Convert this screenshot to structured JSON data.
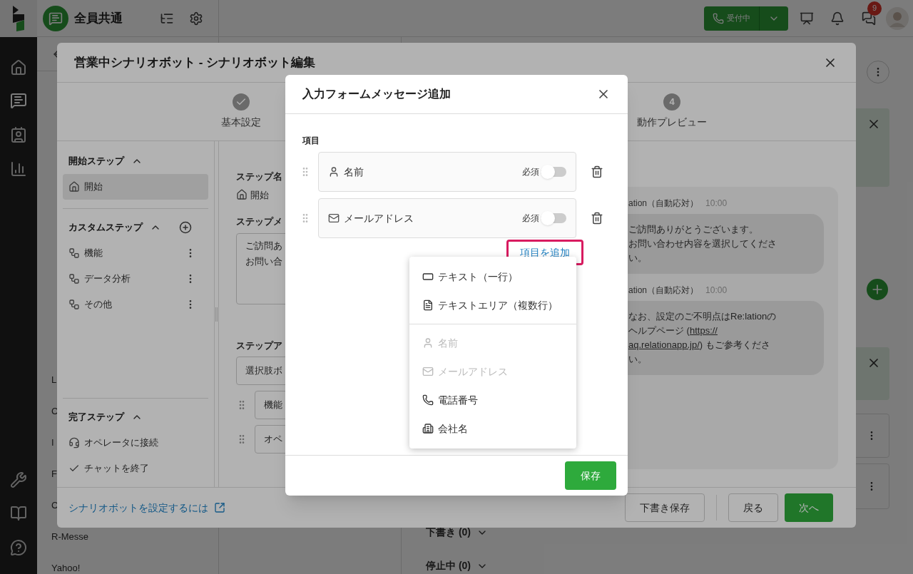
{
  "app": {
    "workspace": "全員共通",
    "status_button": "受付中",
    "badge": "9",
    "nav_list": [
      "L",
      "C",
      "I",
      "F",
      "C",
      "R-Messe",
      "Yahoo!"
    ],
    "sections": [
      {
        "label": "下書き (0)",
        "expanded": false
      },
      {
        "label": "停止中 (0)",
        "expanded": false
      }
    ]
  },
  "editor": {
    "title": "営業中シナリオボット - シナリオボット編集",
    "steps": [
      {
        "label": "基本設定",
        "done": true
      },
      {
        "label": "動作プレビュー",
        "number": "4",
        "done": false
      }
    ],
    "sidebar": [
      {
        "title": "開始ステップ",
        "expanded": true,
        "can_add": false,
        "items": [
          {
            "label": "開始",
            "kind": "start",
            "selected": true,
            "has_menu": false
          }
        ]
      },
      {
        "title": "カスタムステップ",
        "expanded": true,
        "can_add": true,
        "items": [
          {
            "label": "機能",
            "kind": "custom",
            "selected": false,
            "has_menu": true
          },
          {
            "label": "データ分析",
            "kind": "custom",
            "selected": false,
            "has_menu": true
          },
          {
            "label": "その他",
            "kind": "custom",
            "selected": false,
            "has_menu": true
          }
        ]
      },
      {
        "title": "完了ステップ",
        "expanded": true,
        "can_add": false,
        "items": [
          {
            "label": "オペレータに接続",
            "kind": "operator",
            "selected": false,
            "has_menu": false
          },
          {
            "label": "チャットを終了",
            "kind": "finish",
            "selected": false,
            "has_menu": false
          }
        ]
      }
    ],
    "form": {
      "step_name_label": "ステップ名",
      "step_name": "開始",
      "message_label": "ステップメ",
      "message_lines": [
        "ご訪問あ",
        "お問い合"
      ],
      "action_label": "ステップア",
      "action_select": "選択肢ボ",
      "options": [
        "機能",
        "オペ"
      ]
    },
    "preview": [
      {
        "sender": "ation（自動応対）",
        "time": "10:00",
        "lines": [
          [
            {
              "text": "ご訪問ありがとうございます。",
              "link": false
            }
          ],
          [
            {
              "text": "お問い合わせ内容を選択してくださ",
              "link": false
            }
          ],
          [
            {
              "text": "い。",
              "link": false
            }
          ]
        ]
      },
      {
        "sender": "ation（自動応対）",
        "time": "10:00",
        "lines": [
          [
            {
              "text": "なお、設定のご不明点はRe:lationの",
              "link": false
            }
          ],
          [
            {
              "text": "ヘルプページ (",
              "link": false
            },
            {
              "text": "https://",
              "link": true
            }
          ],
          [
            {
              "text": "aq.relationapp.jp/",
              "link": true
            },
            {
              "text": ") もご参考くださ",
              "link": false
            }
          ],
          [
            {
              "text": "い。",
              "link": false
            }
          ]
        ]
      }
    ],
    "help_link": "シナリオボットを設定するには",
    "buttons": [
      {
        "label": "下書き保存",
        "kind": "secondary"
      },
      {
        "label": "戻る",
        "kind": "secondary"
      },
      {
        "label": "次へ",
        "kind": "primary"
      }
    ]
  },
  "dialog": {
    "title": "入力フォームメッセージ追加",
    "section_label": "項目",
    "fields": [
      {
        "label": "名前",
        "kind": "name",
        "required_label": "必須",
        "required": false
      },
      {
        "label": "メールアドレス",
        "kind": "email",
        "required_label": "必須",
        "required": false
      }
    ],
    "add_button": {
      "label": "項目を追加",
      "highlighted": true
    },
    "menu": [
      {
        "items": [
          {
            "label": "テキスト（一行）",
            "kind": "text",
            "disabled": false
          },
          {
            "label": "テキストエリア（複数行）",
            "kind": "textarea",
            "disabled": false
          }
        ]
      },
      {
        "items": [
          {
            "label": "名前",
            "kind": "name",
            "disabled": true
          },
          {
            "label": "メールアドレス",
            "kind": "email",
            "disabled": true
          },
          {
            "label": "電話番号",
            "kind": "phone",
            "disabled": false
          },
          {
            "label": "会社名",
            "kind": "company",
            "disabled": false
          }
        ]
      }
    ],
    "save": "保存"
  }
}
